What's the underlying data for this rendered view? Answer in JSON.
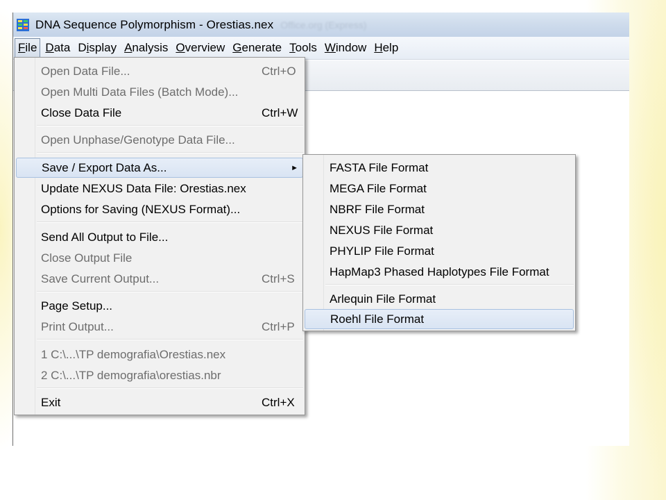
{
  "window": {
    "title": "DNA Sequence Polymorphism - Orestias.nex",
    "title_ghost": "Office.org (Express)"
  },
  "menubar": [
    {
      "label": "File",
      "u": "F",
      "rest": "ile",
      "active": true
    },
    {
      "label": "Data",
      "u": "D",
      "rest": "ata"
    },
    {
      "label": "Display",
      "pre": "D",
      "u": "i",
      "rest": "splay"
    },
    {
      "label": "Analysis",
      "u": "A",
      "rest": "nalysis"
    },
    {
      "label": "Overview",
      "u": "O",
      "rest": "verview"
    },
    {
      "label": "Generate",
      "u": "G",
      "rest": "enerate"
    },
    {
      "label": "Tools",
      "u": "T",
      "rest": "ools"
    },
    {
      "label": "Window",
      "u": "W",
      "rest": "indow"
    },
    {
      "label": "Help",
      "u": "H",
      "rest": "elp"
    }
  ],
  "file_menu": {
    "open_data_file": {
      "label": "Open Data File...",
      "shortcut": "Ctrl+O"
    },
    "open_multi": {
      "label": "Open Multi Data Files (Batch Mode)..."
    },
    "close_data_file": {
      "label": "Close Data File",
      "shortcut": "Ctrl+W"
    },
    "open_unphase": {
      "label": "Open Unphase/Genotype Data File..."
    },
    "save_export": {
      "label": "Save / Export Data As...",
      "arrow": "►"
    },
    "update_nexus": {
      "label": "Update NEXUS Data File:  Orestias.nex"
    },
    "options_saving": {
      "label": "Options for Saving (NEXUS Format)..."
    },
    "send_output": {
      "label": "Send All Output to File..."
    },
    "close_output": {
      "label": "Close Output File"
    },
    "save_current": {
      "label": "Save Current Output...",
      "shortcut": "Ctrl+S"
    },
    "page_setup": {
      "label": "Page Setup..."
    },
    "print_output": {
      "label": "Print Output...",
      "shortcut": "Ctrl+P"
    },
    "recent_1": {
      "label": "1 C:\\...\\TP demografia\\Orestias.nex"
    },
    "recent_2": {
      "label": "2 C:\\...\\TP demografia\\orestias.nbr"
    },
    "exit": {
      "label": "Exit",
      "shortcut": "Ctrl+X"
    }
  },
  "export_submenu": {
    "fasta": "FASTA File Format",
    "mega": "MEGA File Format",
    "nbrf": "NBRF File Format",
    "nexus": "NEXUS File Format",
    "phylip": "PHYLIP File Format",
    "hapmap3": "HapMap3 Phased Haplotypes File Format",
    "arlequin": "Arlequin File Format",
    "roehl": "Roehl File Format"
  },
  "colors": {
    "title_bar": "#cfdcec",
    "menu_hover": "#d9e4f3",
    "disabled_text": "#6d6d6d"
  },
  "icons": {
    "app": "dnasp-app-icon",
    "submenu": "chevron-right-icon"
  }
}
